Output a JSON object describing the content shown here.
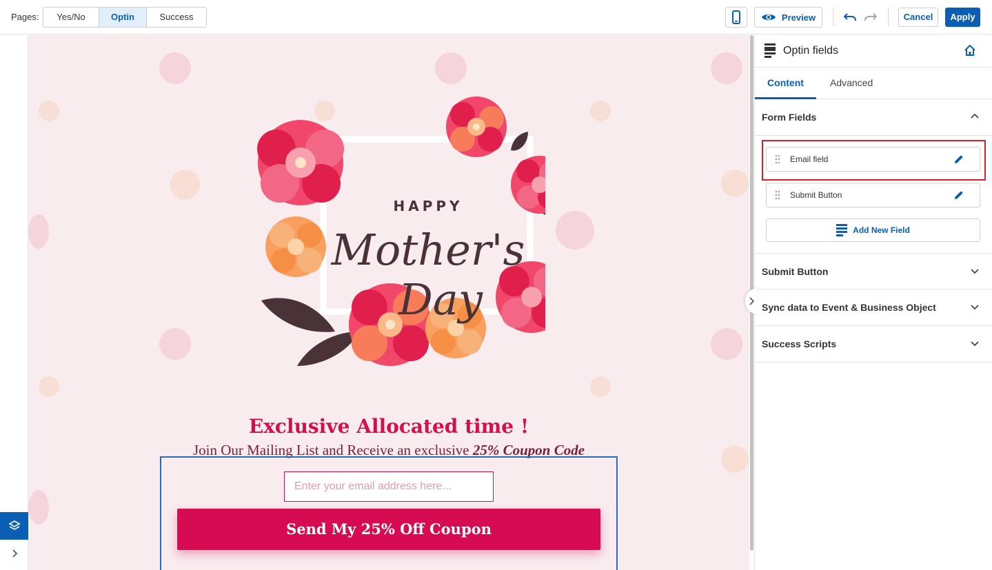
{
  "topbar": {
    "pages_label": "Pages:",
    "pages": [
      "Yes/No",
      "Optin",
      "Success"
    ],
    "active_page": "Optin",
    "device_icon": "mobile-icon",
    "preview_label": "Preview",
    "preview_icon": "eye-icon",
    "undo_icon": "undo-icon",
    "redo_icon": "redo-icon",
    "cancel_label": "Cancel",
    "apply_label": "Apply"
  },
  "canvas": {
    "hero_image": {
      "happy": "HAPPY",
      "mothers": "Mother's",
      "day": "Day"
    },
    "headline": "Exclusive Allocated time !",
    "subline_text": "Join Our Mailing List and Receive an exclusive ",
    "subline_coupon": "25% Coupon Code",
    "email_placeholder": "Enter your email address here...",
    "submit_label": "Send My 25% Off Coupon"
  },
  "panel": {
    "title": "Optin fields",
    "tabs": [
      "Content",
      "Advanced"
    ],
    "active_tab": "Content",
    "form_fields_title": "Form Fields",
    "fields": [
      {
        "label": "Email field"
      },
      {
        "label": "Submit Button"
      }
    ],
    "add_field_label": "Add New Field",
    "sections": [
      "Submit Button",
      "Sync data to Event & Business Object",
      "Success Scripts"
    ]
  },
  "colors": {
    "accent": "#0a5fb4",
    "brand_pink": "#d70b52",
    "canvas_bg": "#f8ecef",
    "highlight": "#e01b24"
  }
}
